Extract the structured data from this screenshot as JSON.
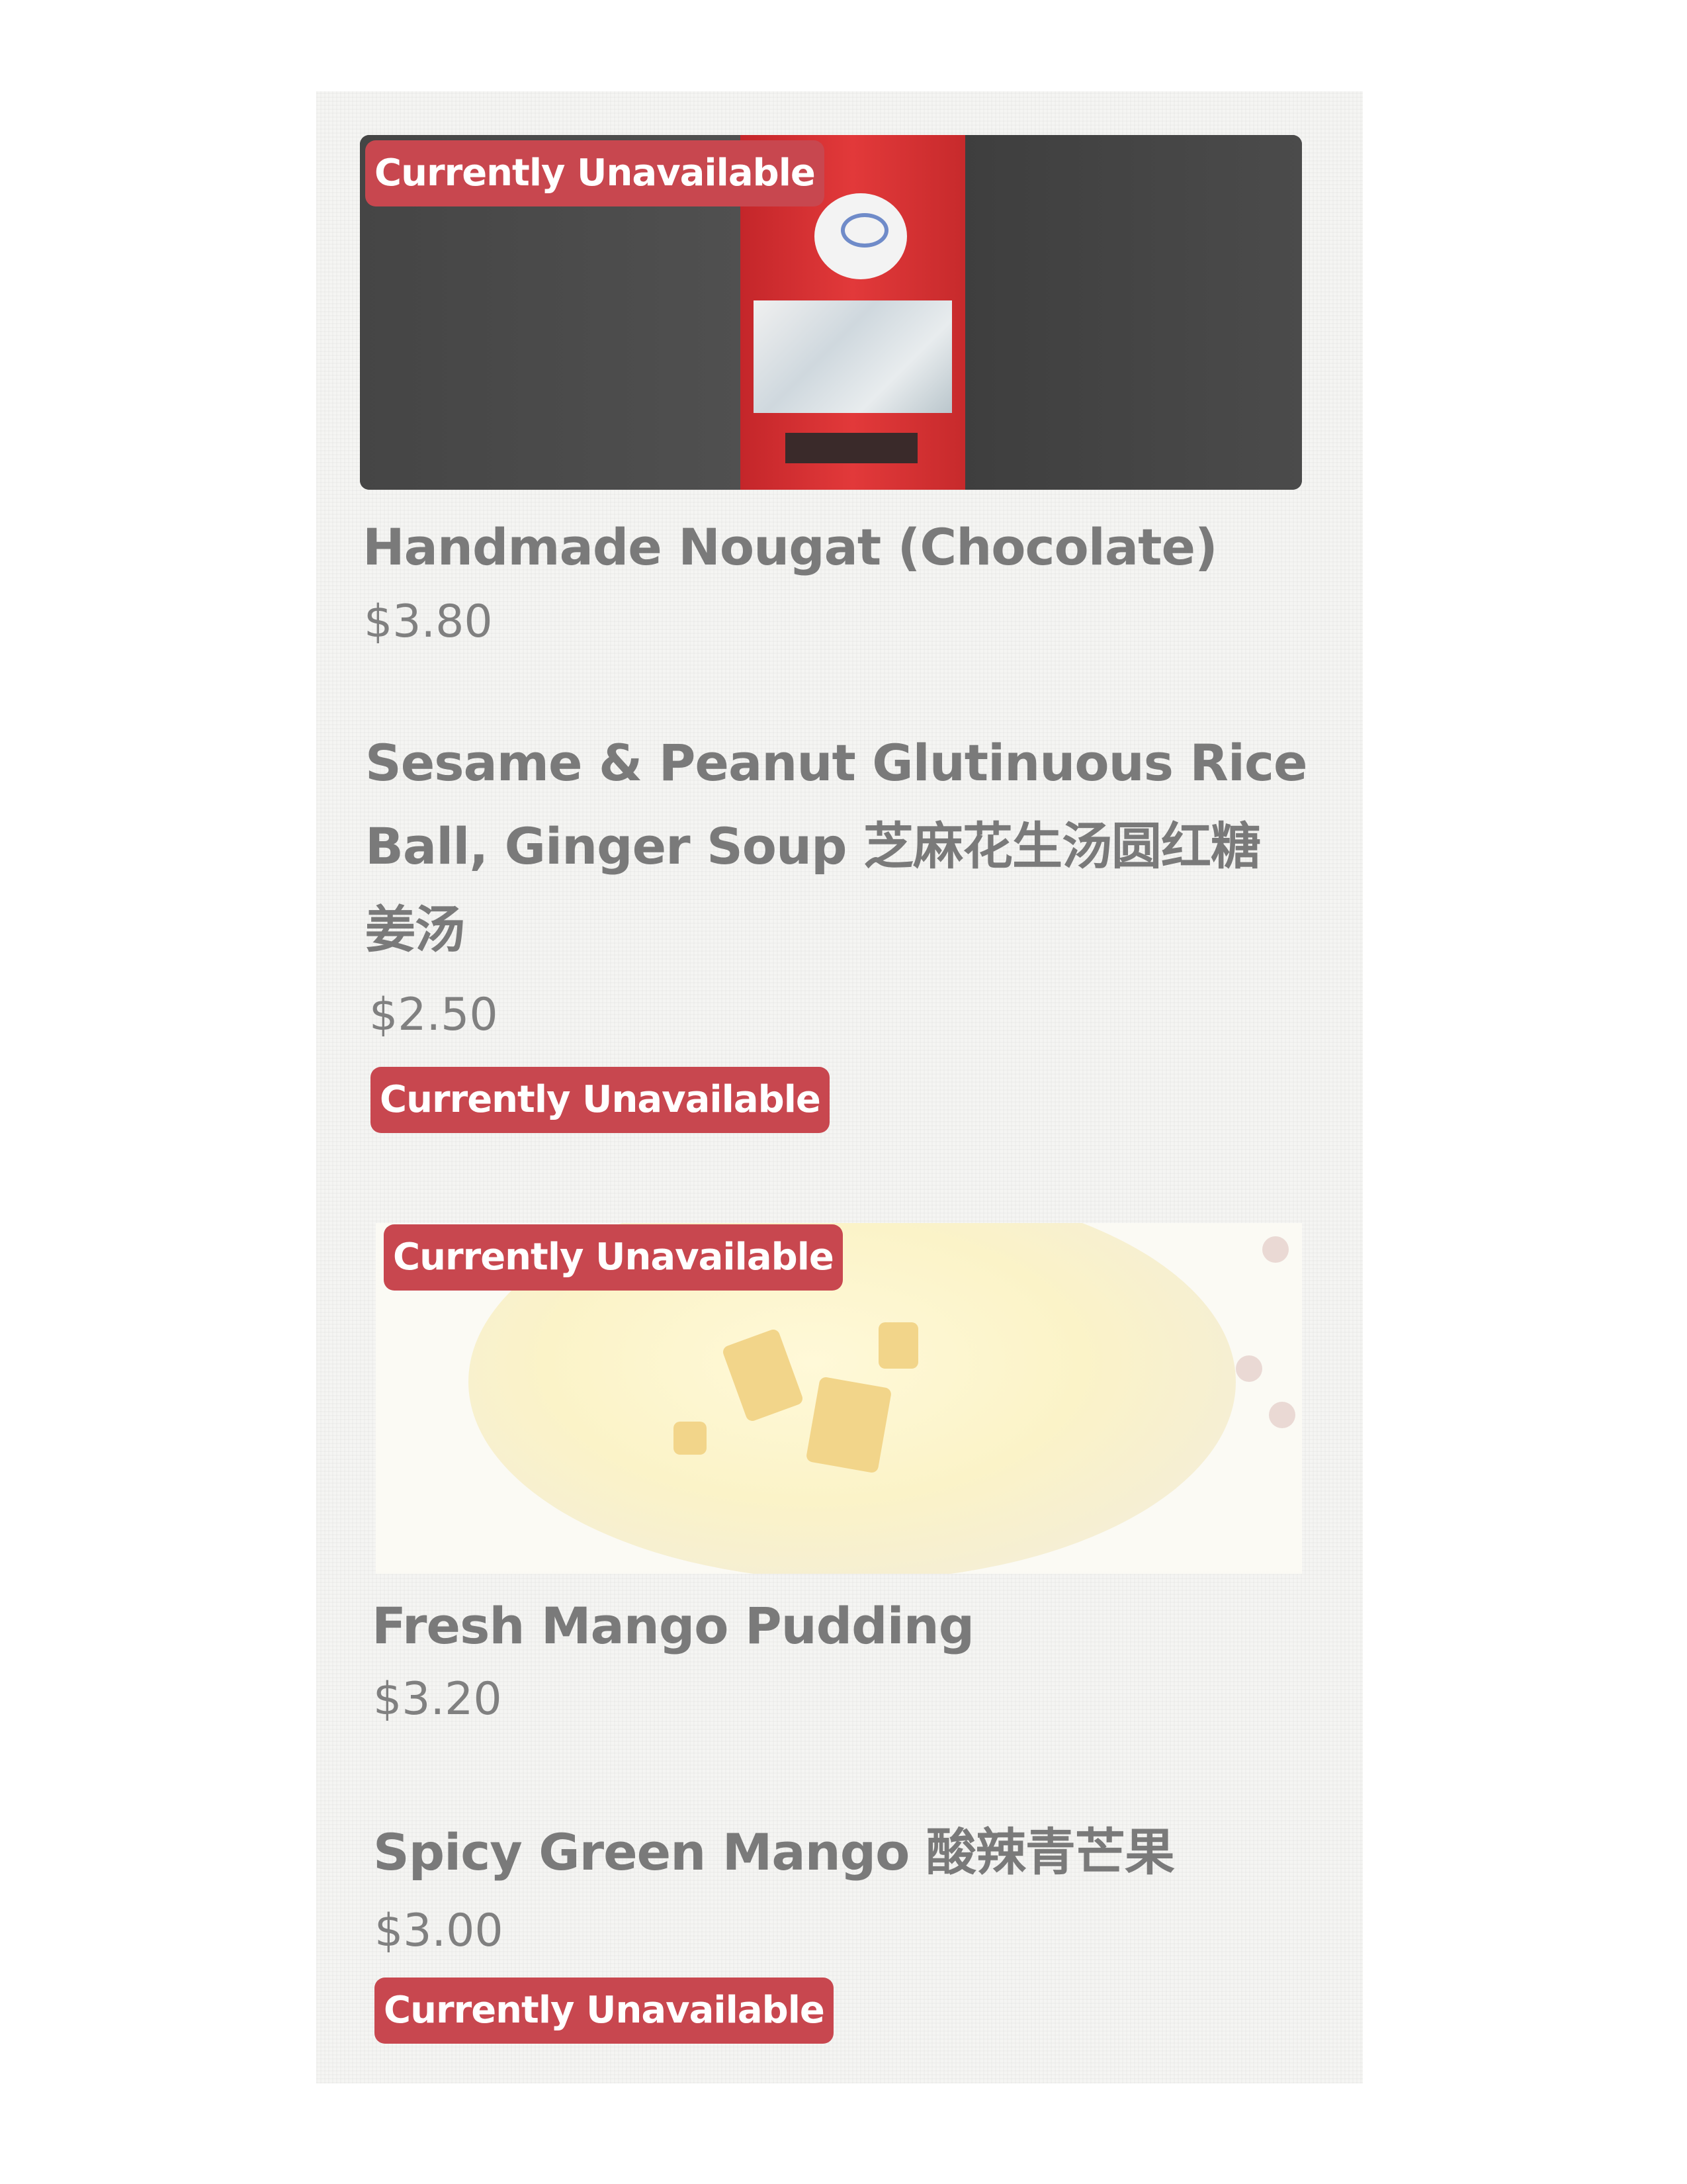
{
  "badge_text": "Currently Unavailable",
  "items": [
    {
      "name": "Handmade Nougat (Chocolate)",
      "price": "$3.80",
      "image_badge": "Currently Unavailable"
    },
    {
      "name_line1": "Sesame & Peanut Glutinuous Rice",
      "name_line2": "Ball, Ginger Soup 芝麻花生汤圆红糖",
      "name_line3": "姜汤",
      "price": "$2.50",
      "badge": "Currently Unavailable"
    },
    {
      "name": "Fresh Mango Pudding",
      "price": "$3.20",
      "image_badge": "Currently Unavailable"
    },
    {
      "name": "Spicy Green Mango 酸辣青芒果",
      "price": "$3.00",
      "badge": "Currently Unavailable"
    }
  ],
  "colors": {
    "badge_bg": "#c8474f",
    "text": "#7a7a7a",
    "bag_red": "#e2393a"
  }
}
